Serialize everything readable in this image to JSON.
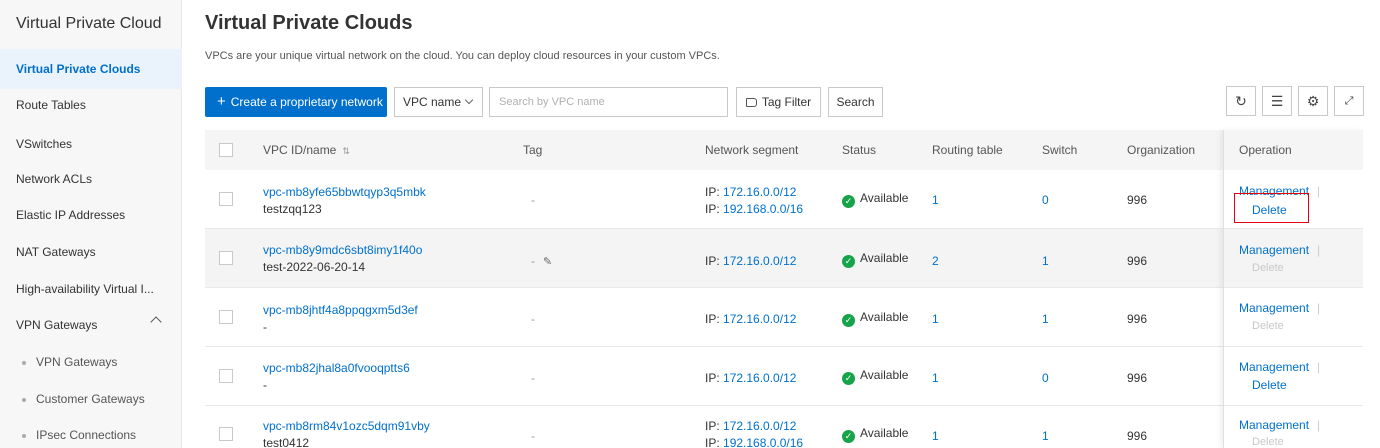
{
  "sidebar": {
    "title": "Virtual Private Cloud",
    "items": [
      {
        "label": "Virtual Private Clouds"
      },
      {
        "label": "Route Tables"
      },
      {
        "label": "VSwitches"
      },
      {
        "label": "Network ACLs"
      },
      {
        "label": "Elastic IP Addresses"
      },
      {
        "label": "NAT Gateways"
      },
      {
        "label": "High-availability Virtual I..."
      },
      {
        "label": "VPN Gateways"
      }
    ],
    "sub_items": [
      {
        "label": "VPN Gateways"
      },
      {
        "label": "Customer Gateways"
      },
      {
        "label": "IPsec Connections"
      }
    ]
  },
  "header": {
    "title": "Virtual Private Clouds",
    "description": "VPCs are your unique virtual network on the cloud. You can deploy cloud resources in your custom VPCs."
  },
  "toolbar": {
    "create_label": "Create a proprietary network",
    "filter_select": "VPC name",
    "search_placeholder": "Search by VPC name",
    "tag_filter_label": "Tag Filter",
    "search_label": "Search",
    "icons": [
      "refresh-icon",
      "list-settings-icon",
      "gear-icon",
      "fullscreen-icon"
    ]
  },
  "table": {
    "columns": {
      "id": "VPC ID/name",
      "tag": "Tag",
      "segment": "Network segment",
      "status": "Status",
      "routing": "Routing table",
      "switch": "Switch",
      "org": "Organization",
      "op": "Operation"
    },
    "ip_prefix": "IP:",
    "status_label": "Available",
    "op_management": "Management",
    "op_delete": "Delete",
    "rows": [
      {
        "id": "vpc-mb8yfe65bbwtqyp3q5mbk",
        "name": "testzqq123",
        "tag": "-",
        "ip1": "172.16.0.0/12",
        "ip2": "192.168.0.0/16",
        "routing": "1",
        "switch": "0",
        "org": "996"
      },
      {
        "id": "vpc-mb8y9mdc6sbt8imy1f40o",
        "name": "test-2022-06-20-14",
        "tag": "-",
        "ip1": "172.16.0.0/12",
        "ip2": "",
        "routing": "2",
        "switch": "1",
        "org": "996"
      },
      {
        "id": "vpc-mb8jhtf4a8ppqgxm5d3ef",
        "name": "-",
        "tag": "-",
        "ip1": "172.16.0.0/12",
        "ip2": "",
        "routing": "1",
        "switch": "1",
        "org": "996"
      },
      {
        "id": "vpc-mb82jhal8a0fvooqptts6",
        "name": "-",
        "tag": "-",
        "ip1": "172.16.0.0/12",
        "ip2": "",
        "routing": "1",
        "switch": "0",
        "org": "996"
      },
      {
        "id": "vpc-mb8rm84v1ozc5dqm91vby",
        "name": "test0412",
        "tag": "-",
        "ip1": "172.16.0.0/12",
        "ip2": "192.168.0.0/16",
        "routing": "1",
        "switch": "1",
        "org": "996"
      }
    ]
  },
  "colors": {
    "accent": "#0070cc",
    "available": "#16a34a",
    "highlight_box": "#e60012"
  }
}
